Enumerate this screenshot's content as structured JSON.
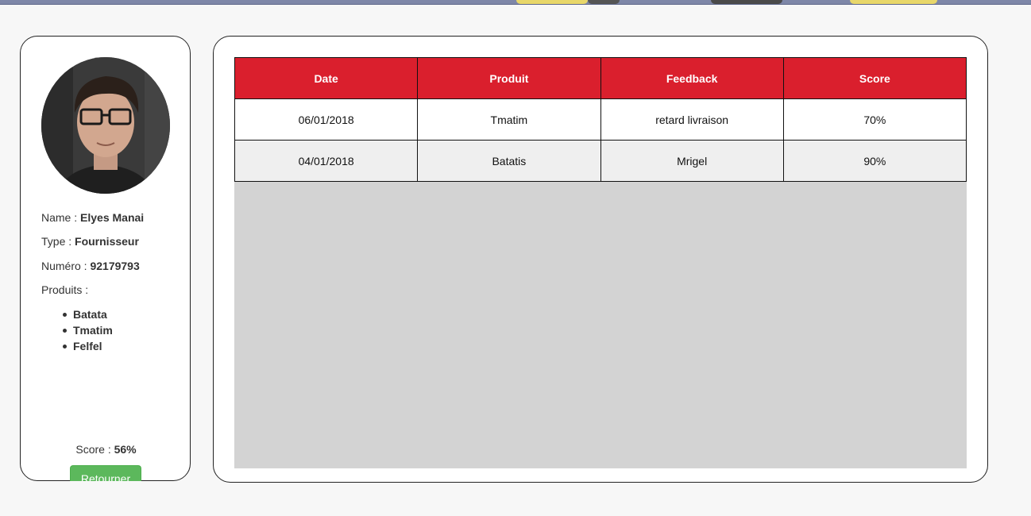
{
  "colors": {
    "header_red": "#da1f2d",
    "button_green": "#5cb85c",
    "empty_area": "#d3d3d3",
    "alt_row": "#efefef"
  },
  "profile": {
    "name_label": "Name :",
    "name_value": "Elyes Manai",
    "type_label": "Type :",
    "type_value": "Fournisseur",
    "number_label": "Numéro :",
    "number_value": "92179793",
    "products_label": "Produits :",
    "products": [
      "Batata",
      "Tmatim",
      "Felfel"
    ],
    "score_label": "Score :",
    "score_value": "56%",
    "back_button_label": "Retourner"
  },
  "table": {
    "headers": [
      "Date",
      "Produit",
      "Feedback",
      "Score"
    ],
    "rows": [
      [
        "06/01/2018",
        "Tmatim",
        "retard livraison",
        "70%"
      ],
      [
        "04/01/2018",
        "Batatis",
        "Mrigel",
        "90%"
      ]
    ]
  }
}
